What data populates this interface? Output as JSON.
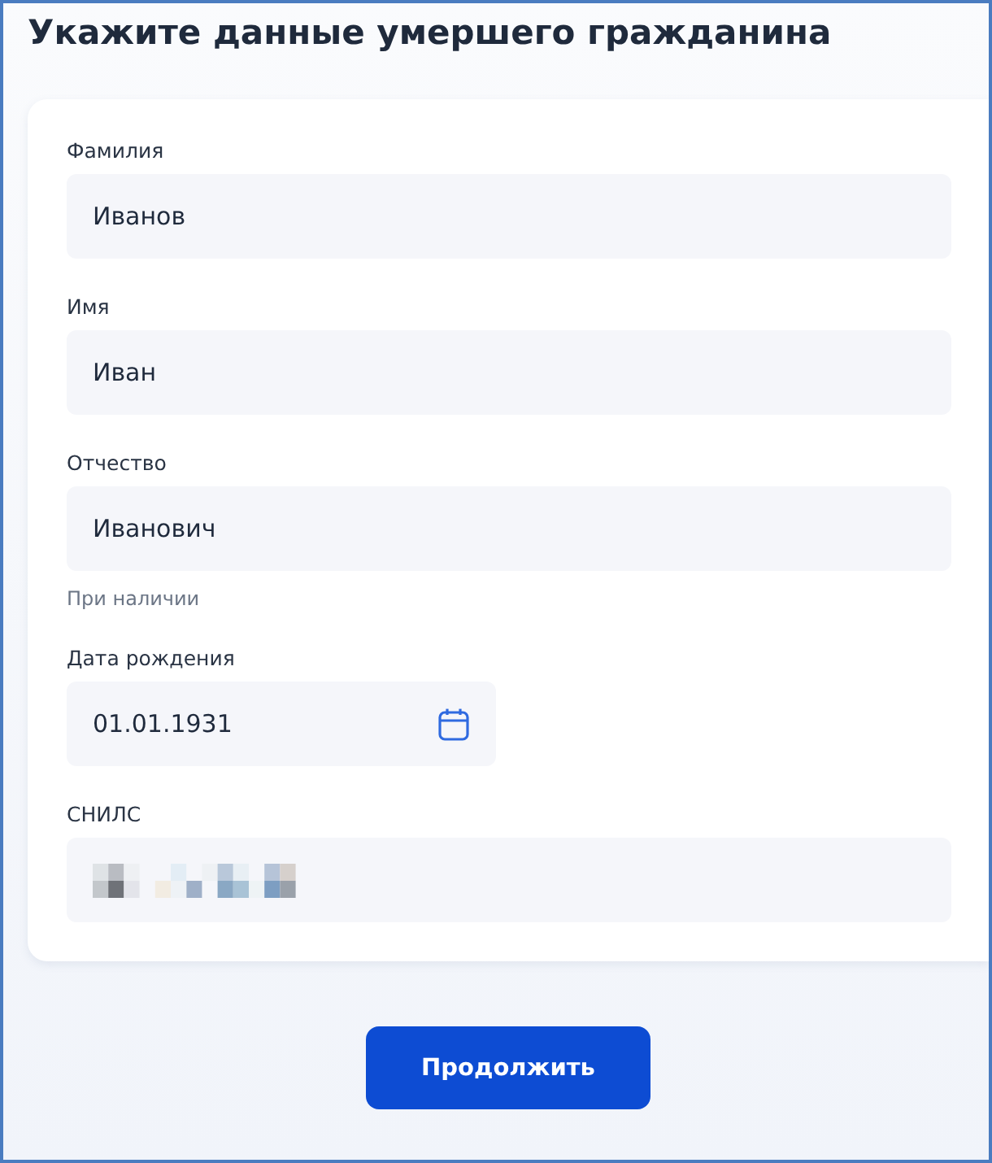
{
  "title": "Укажите данные умершего гражданина",
  "fields": [
    {
      "kind": "text",
      "label": "Фамилия",
      "value": "Иванов"
    },
    {
      "kind": "text",
      "label": "Имя",
      "value": "Иван"
    },
    {
      "kind": "text",
      "label": "Отчество",
      "value": "Иванович",
      "hint": "При наличии"
    },
    {
      "kind": "date",
      "label": "Дата рождения",
      "value": "01.01.1931"
    },
    {
      "kind": "redacted",
      "label": "СНИЛС"
    }
  ],
  "button": "Продолжить"
}
